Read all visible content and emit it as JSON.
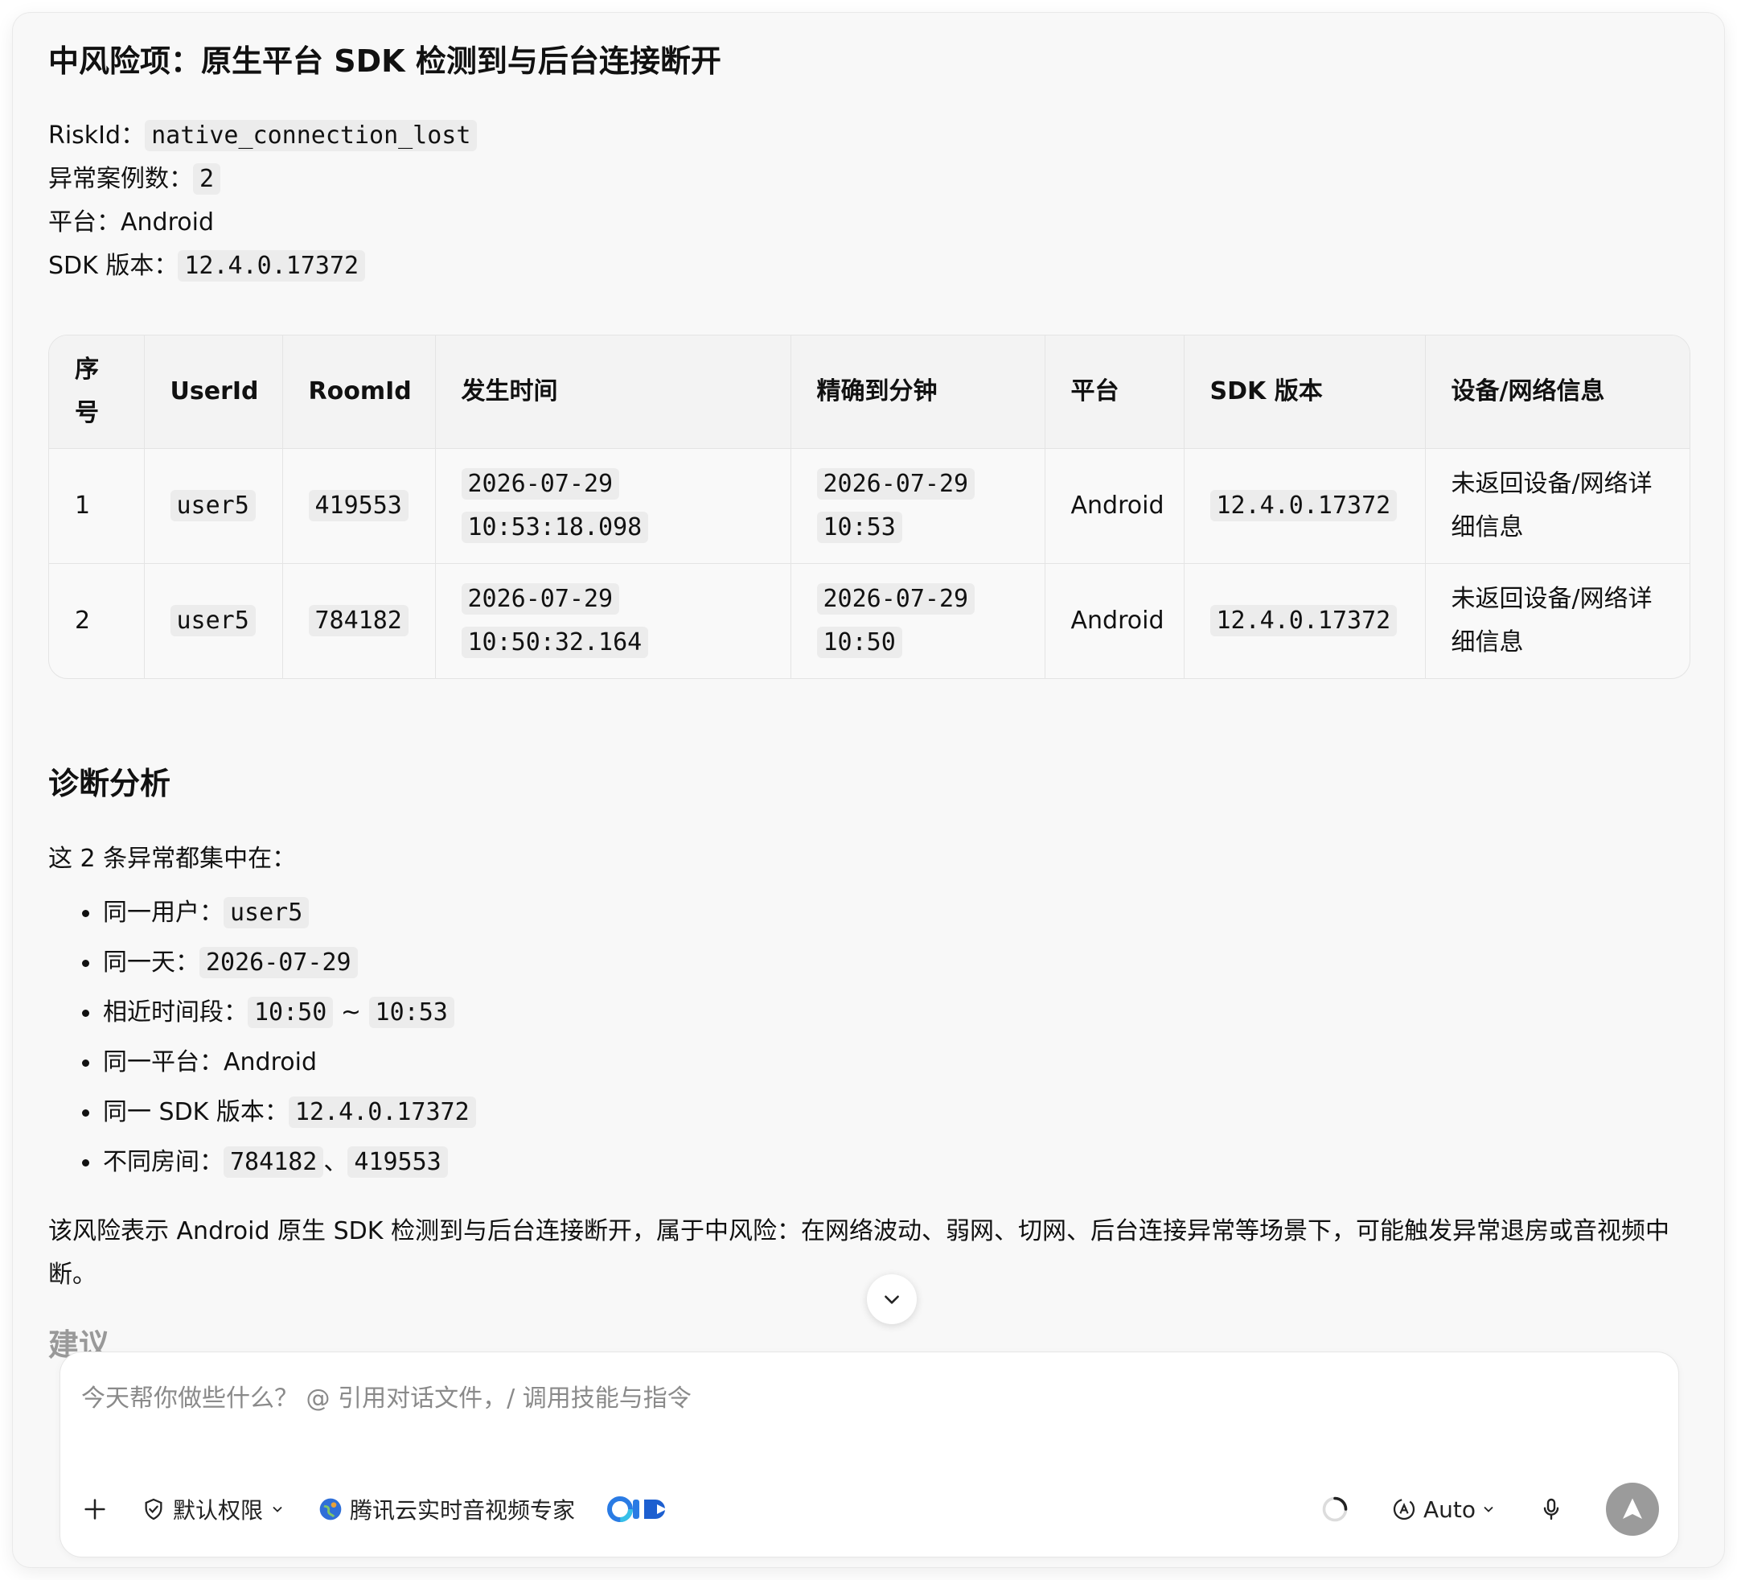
{
  "risk": {
    "title": "中风险项：原生平台 SDK 检测到与后台连接断开",
    "riskid_label": "RiskId：",
    "riskid_value": "native_connection_lost",
    "count_label": "异常案例数：",
    "count_value": "2",
    "platform_label": "平台：",
    "platform_value": "Android",
    "sdk_label": "SDK 版本：",
    "sdk_value": "12.4.0.17372"
  },
  "table": {
    "headers": [
      "序号",
      "UserId",
      "RoomId",
      "发生时间",
      "精确到分钟",
      "平台",
      "SDK 版本",
      "设备/网络信息"
    ],
    "rows": [
      {
        "index": "1",
        "user": "user5",
        "room": "419553",
        "time_date": "2026-07-29",
        "time_clock": "10:53:18.098",
        "minute_date": "2026-07-29",
        "minute_clock": "10:53",
        "platform": "Android",
        "sdk": "12.4.0.17372",
        "device": "未返回设备/网络详细信息"
      },
      {
        "index": "2",
        "user": "user5",
        "room": "784182",
        "time_date": "2026-07-29",
        "time_clock": "10:50:32.164",
        "minute_date": "2026-07-29",
        "minute_clock": "10:50",
        "platform": "Android",
        "sdk": "12.4.0.17372",
        "device": "未返回设备/网络详细信息"
      }
    ]
  },
  "diagnosis": {
    "heading": "诊断分析",
    "intro": "这 2 条异常都集中在：",
    "b1_label": "同一用户：",
    "b1_value": "user5",
    "b2_label": "同一天：",
    "b2_value": "2026-07-29",
    "b3_label": "相近时间段：",
    "b3_from": "10:50",
    "b3_sep": " ~ ",
    "b3_to": "10:53",
    "b4_label": "同一平台：",
    "b4_value": "Android",
    "b5_label": "同一 SDK 版本：",
    "b5_value": "12.4.0.17372",
    "b6_label": "不同房间：",
    "b6_value1": "784182",
    "b6_sep": "、",
    "b6_value2": "419553",
    "paragraph": "该风险表示 Android 原生 SDK 检测到与后台连接断开，属于中风险：在网络波动、弱网、切网、后台连接异常等场景下，可能触发异常退房或音视频中断。",
    "next_heading": "建议"
  },
  "composer": {
    "placeholder": "今天帮你做些什么？ @ 引用对话文件，/ 调用技能与指令",
    "permission_label": "默认权限",
    "agent_label": "腾讯云实时音视频专家",
    "model_label": "Auto"
  },
  "icons": {
    "add": "plus-icon",
    "permission": "shield-check-icon",
    "agent": "globe-avatar-icon",
    "brand": "brand-logo-icon",
    "loading": "spinner-icon",
    "model": "auto-model-icon",
    "mic": "microphone-icon",
    "send": "send-arrow-icon",
    "scroll": "chevron-down-icon"
  }
}
